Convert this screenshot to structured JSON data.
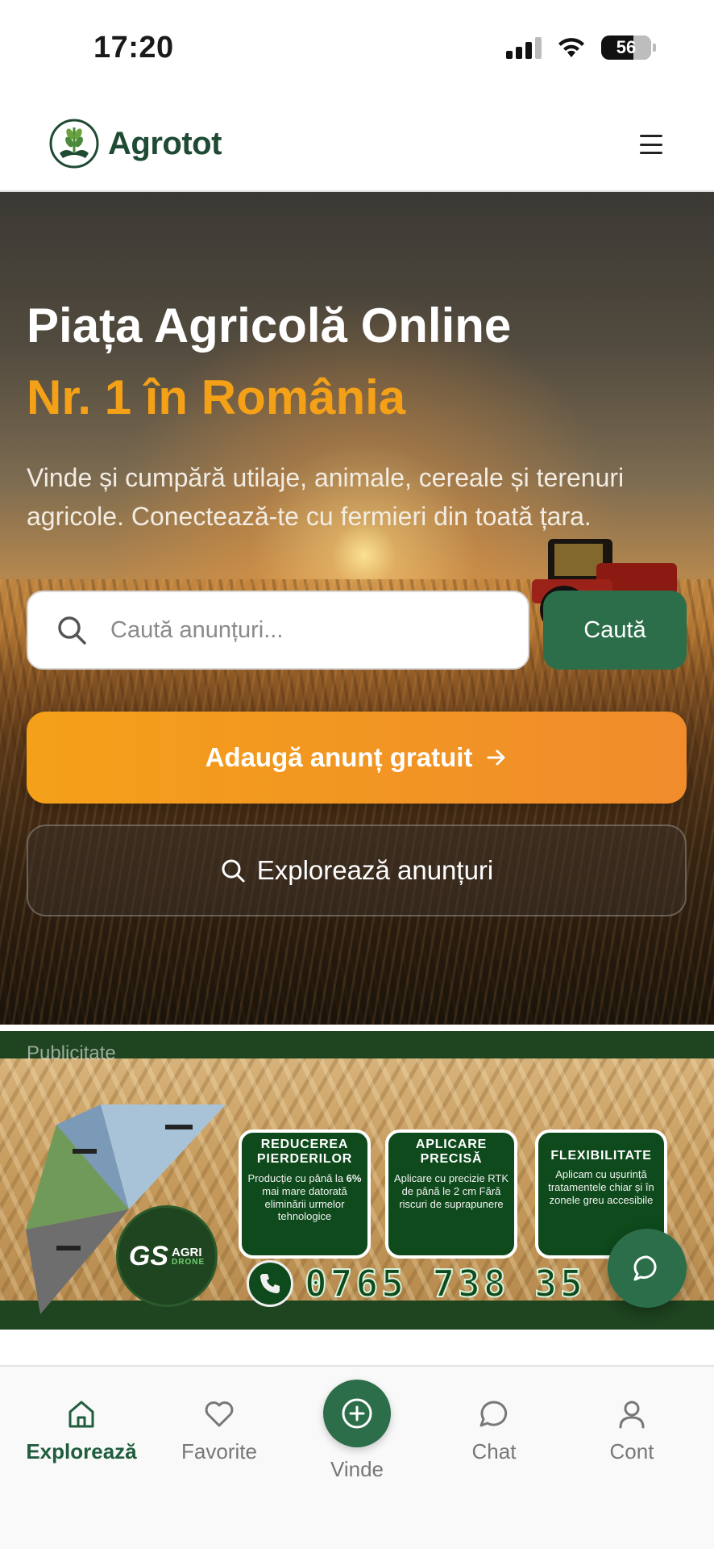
{
  "status_bar": {
    "time": "17:20",
    "battery": "56"
  },
  "header": {
    "brand": "Agrotot",
    "menu_icon": "hamburger-menu-icon"
  },
  "hero": {
    "title": "Piața Agricolă Online",
    "subtitle": "Nr. 1 în România",
    "description": "Vinde și cumpără utilaje, animale, cereale și terenuri agricole. Conectează-te cu fermieri din toată țara.",
    "search": {
      "placeholder": "Caută anunțuri...",
      "value": "",
      "button_label": "Caută"
    },
    "add_button_label": "Adaugă anunț gratuit",
    "explore_button_label": "Explorează anunțuri"
  },
  "ad": {
    "label": "Publicitate",
    "logo": {
      "main": "GS",
      "sub1": "AGRI",
      "sub2": "DRONE"
    },
    "cards": [
      {
        "title": "REDUCEREA PIERDERILOR",
        "text_before": "Producție cu până la ",
        "highlight": "6%",
        "text_after": " mai mare datorată eliminării urmelor tehnologice"
      },
      {
        "title": "APLICARE PRECISĂ",
        "text": "Aplicare cu precizie RTK de până le 2 cm Fără riscuri de suprapunere"
      },
      {
        "title": "FLEXIBILITATE",
        "text": "Aplicam cu ușurință tratamentele chiar și în zonele greu accesibile"
      }
    ],
    "phone": "0765 738 35"
  },
  "bottom_nav": {
    "items": [
      {
        "label": "Explorează",
        "icon": "home-icon",
        "active": true
      },
      {
        "label": "Favorite",
        "icon": "heart-icon",
        "active": false
      },
      {
        "label": "Vinde",
        "icon": "plus-circle-icon",
        "active": false
      },
      {
        "label": "Chat",
        "icon": "chat-bubble-icon",
        "active": false
      },
      {
        "label": "Cont",
        "icon": "user-icon",
        "active": false
      }
    ]
  },
  "colors": {
    "primary_green": "#2c6e4a",
    "accent_orange": "#f4a117",
    "brand_dark": "#1f4a33"
  }
}
